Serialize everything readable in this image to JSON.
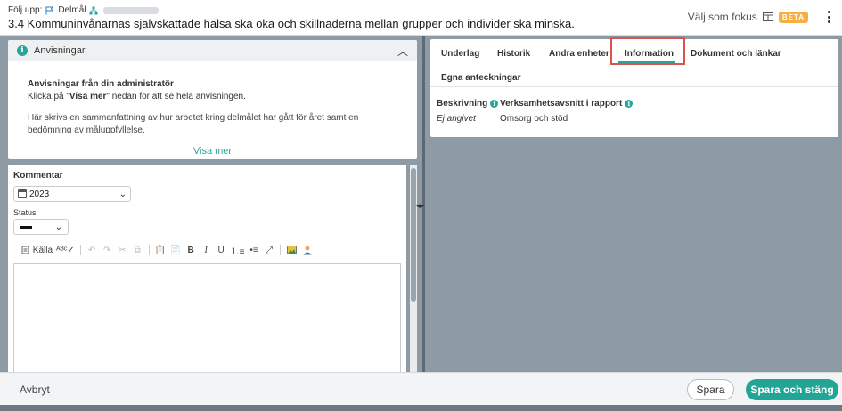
{
  "header": {
    "breadcrumb_prefix": "Följ upp:",
    "breadcrumb_item": "Delmål",
    "title": "3.4 Kommuninvånarnas självskattade hälsa ska öka och skillnaderna mellan grupper och individer ska minska.",
    "focus_label": "Välj som fokus",
    "beta_label": "BETA"
  },
  "instructions": {
    "heading": "Anvisningar",
    "admin_title": "Anvisningar från din administratör",
    "hint_prefix": "Klicka på \"",
    "hint_link": "Visa mer",
    "hint_suffix": "\" nedan för att se hela anvisningen.",
    "summary": "Här skrivs en sammanfattning av hur arbetet kring delmålet har gått för året samt en bedömning av måluppfyllelse.",
    "show_more": "Visa mer"
  },
  "comment": {
    "label": "Kommentar",
    "year": "2023",
    "status_label": "Status"
  },
  "toolbar": {
    "source_label": "Källa",
    "bold_label": "B",
    "italic_label": "I",
    "underline_label": "U"
  },
  "tabs": [
    {
      "label": "Underlag"
    },
    {
      "label": "Historik"
    },
    {
      "label": "Andra enheter"
    },
    {
      "label": "Information",
      "active": true
    },
    {
      "label": "Dokument och länkar"
    },
    {
      "label": "Egna anteckningar"
    }
  ],
  "information": {
    "desc_label": "Beskrivning",
    "desc_value": "Ej angivet",
    "section_label": "Verksamhetsavsnitt i rapport",
    "section_value": "Omsorg och stöd"
  },
  "footer": {
    "cancel": "Avbryt",
    "save": "Spara",
    "save_close": "Spara och stäng"
  },
  "colors": {
    "accent": "#22a597",
    "highlight": "#d9534f",
    "beta": "#f5b041"
  }
}
